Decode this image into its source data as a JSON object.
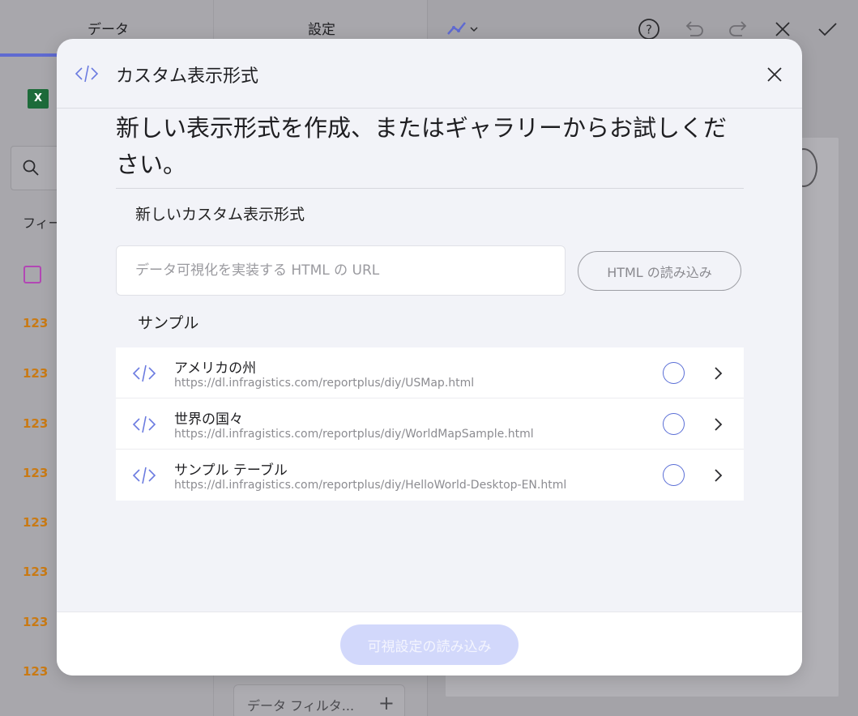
{
  "background": {
    "tabs": [
      "データ",
      "設定"
    ],
    "toolbar_icons": [
      "line-chart-icon",
      "help-icon",
      "undo-icon",
      "redo-icon",
      "close-icon",
      "check-icon"
    ],
    "sidebar_section": "フィー",
    "field_type_label": "123",
    "filter_placeholder": "データ フィルタ...",
    "filter_add": "+"
  },
  "modal": {
    "title": "カスタム表示形式",
    "intro": "新しい表示形式を作成、またはギャラリーからお試しください。",
    "new_section_label": "新しいカスタム表示形式",
    "url_placeholder": "データ可視化を実装する HTML の URL",
    "url_value": "",
    "load_html_label": "HTML の読み込み",
    "samples_label": "サンプル",
    "samples": [
      {
        "title": "アメリカの州",
        "url": "https://dl.infragistics.com/reportplus/diy/USMap.html"
      },
      {
        "title": "世界の国々",
        "url": "https://dl.infragistics.com/reportplus/diy/WorldMapSample.html"
      },
      {
        "title": "サンプル テーブル",
        "url": "https://dl.infragistics.com/reportplus/diy/HelloWorld-Desktop-EN.html"
      }
    ],
    "load_viz_label": "可視設定の読み込み"
  },
  "colors": {
    "accent": "#6b7be0",
    "radio": "#5a6ed6",
    "primary_disabled": "#d2d8fb",
    "number_type": "#c97a14"
  }
}
